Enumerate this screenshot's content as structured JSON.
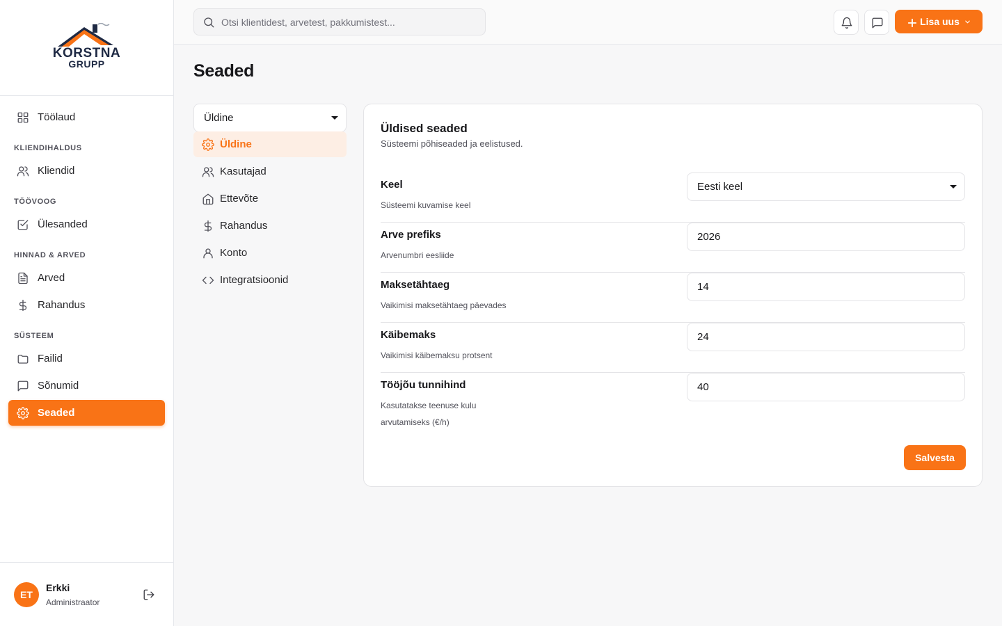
{
  "logo": {
    "line1": "KORSTNA",
    "line2": "GRUPP"
  },
  "sidebar": {
    "top_item": {
      "label": "Töölaud",
      "icon": "dashboard-icon"
    },
    "sections": [
      {
        "title": "KLIENDIHALDUS",
        "items": [
          {
            "label": "Kliendid",
            "icon": "users-icon"
          }
        ]
      },
      {
        "title": "TÖÖVOOG",
        "items": [
          {
            "label": "Ülesanded",
            "icon": "checkbox-icon"
          }
        ]
      },
      {
        "title": "HINNAD & ARVED",
        "items": [
          {
            "label": "Arved",
            "icon": "document-icon"
          },
          {
            "label": "Rahandus",
            "icon": "dollar-icon"
          }
        ]
      },
      {
        "title": "SÜSTEEM",
        "items": [
          {
            "label": "Failid",
            "icon": "folder-icon"
          },
          {
            "label": "Sõnumid",
            "icon": "message-icon"
          },
          {
            "label": "Seaded",
            "icon": "gear-icon",
            "active": true
          }
        ]
      }
    ]
  },
  "user": {
    "initials": "ET",
    "name": "Erkki",
    "role": "Administraator"
  },
  "topbar": {
    "search_placeholder": "Otsi klientidest, arvetest, pakkumistest...",
    "add_label": "Lisa uus"
  },
  "page": {
    "title": "Seaded"
  },
  "settings_nav": {
    "selected": "Üldine",
    "items": [
      {
        "label": "Üldine",
        "icon": "gear-icon",
        "active": true
      },
      {
        "label": "Kasutajad",
        "icon": "users-icon"
      },
      {
        "label": "Ettevõte",
        "icon": "home-icon"
      },
      {
        "label": "Rahandus",
        "icon": "dollar-icon"
      },
      {
        "label": "Konto",
        "icon": "user-icon"
      },
      {
        "label": "Integratsioonid",
        "icon": "code-icon"
      }
    ]
  },
  "general": {
    "title": "Üldised seaded",
    "subtitle": "Süsteemi põhiseaded ja eelistused.",
    "fields": {
      "language": {
        "label": "Keel",
        "description": "Süsteemi kuvamise keel",
        "value": "Eesti keel"
      },
      "invoice_prefix": {
        "label": "Arve prefiks",
        "description": "Arvenumbri eesliide",
        "value": "2026"
      },
      "due_days": {
        "label": "Maksetähtaeg",
        "description": "Vaikimisi maksetähtaeg päevades",
        "value": "14"
      },
      "vat": {
        "label": "Käibemaks",
        "description": "Vaikimisi käibemaksu protsent",
        "value": "24"
      },
      "labor_rate": {
        "label": "Tööjõu tunnihind",
        "description": "Kasutatakse teenuse kulu arvutamiseks (€/h)",
        "value": "40"
      }
    },
    "save_label": "Salvesta"
  },
  "colors": {
    "accent": "#f97316",
    "accent_soft": "#fdeee4",
    "text": "#18181b",
    "muted": "#52525b",
    "border": "#e4e4e7"
  }
}
